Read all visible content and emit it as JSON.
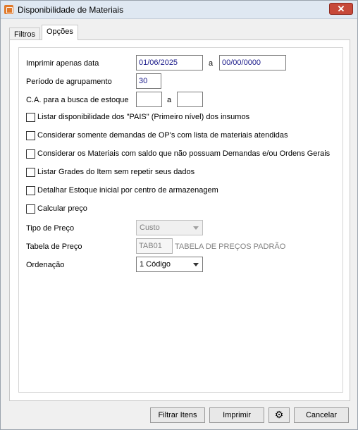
{
  "window": {
    "title": "Disponibilidade de Materiais",
    "close_glyph": "✕"
  },
  "tabs": [
    {
      "label": "Filtros"
    },
    {
      "label": "Opções",
      "active": true
    }
  ],
  "form": {
    "imprimir_label": "Imprimir apenas data",
    "data_inicio": "01/06/2025",
    "a_label": "a",
    "data_fim": "00/00/0000",
    "periodo_label": "Período de agrupamento",
    "periodo_value": "30",
    "ca_label": "C.A. para a busca de estoque",
    "ca_inicio": "",
    "ca_a_label": "a",
    "ca_fim": "",
    "checkboxes": [
      {
        "label": "Listar disponibilidade dos \"PAIS\" (Primeiro nível) dos insumos",
        "checked": false
      },
      {
        "label": "Considerar somente demandas de OP's com lista de materiais atendidas",
        "checked": false
      },
      {
        "label": "Considerar os Materiais com saldo que não possuam Demandas e/ou Ordens Gerais",
        "checked": false
      },
      {
        "label": "Listar Grades do Item sem repetir seus dados",
        "checked": false
      },
      {
        "label": "Detalhar Estoque inicial por centro de armazenagem",
        "checked": false
      },
      {
        "label": "Calcular preço",
        "checked": false
      }
    ],
    "tipo_preco_label": "Tipo de Preço",
    "tipo_preco_value": "Custo",
    "tabela_preco_label": "Tabela de Preço",
    "tabela_preco_code": "TAB01",
    "tabela_preco_desc": "TABELA DE PREÇOS PADRÃO",
    "ordenacao_label": "Ordenação",
    "ordenacao_value": "1 Código"
  },
  "buttons": {
    "filtrar": "Filtrar Itens",
    "imprimir": "Imprimir",
    "settings_icon": "gear-icon",
    "cancelar": "Cancelar"
  }
}
